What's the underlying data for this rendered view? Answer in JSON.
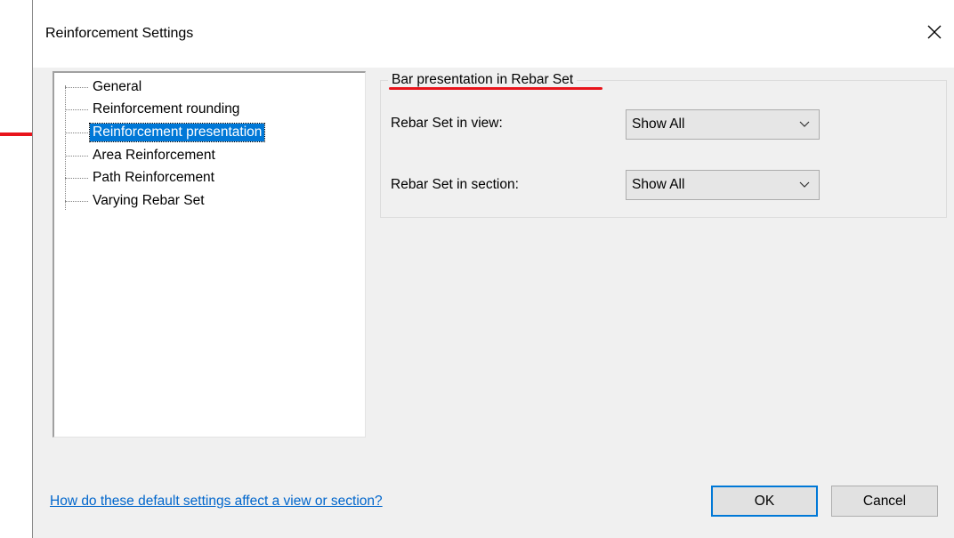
{
  "window": {
    "title": "Reinforcement Settings",
    "close_glyph": "✕"
  },
  "tree": {
    "items": [
      {
        "label": "General",
        "selected": false
      },
      {
        "label": "Reinforcement rounding",
        "selected": false
      },
      {
        "label": "Reinforcement presentation",
        "selected": true
      },
      {
        "label": "Area Reinforcement",
        "selected": false
      },
      {
        "label": "Path Reinforcement",
        "selected": false
      },
      {
        "label": "Varying Rebar Set",
        "selected": false
      }
    ]
  },
  "group": {
    "title": "Bar presentation in Rebar Set",
    "fields": [
      {
        "label": "Rebar Set in view:",
        "value": "Show All"
      },
      {
        "label": "Rebar Set in section:",
        "value": "Show All"
      }
    ]
  },
  "help_link": "How do these default settings affect a view or section?",
  "buttons": {
    "ok": "OK",
    "cancel": "Cancel"
  },
  "colors": {
    "selection": "#0078d7",
    "annotation_red": "#e8141b",
    "link": "#0066cc"
  }
}
